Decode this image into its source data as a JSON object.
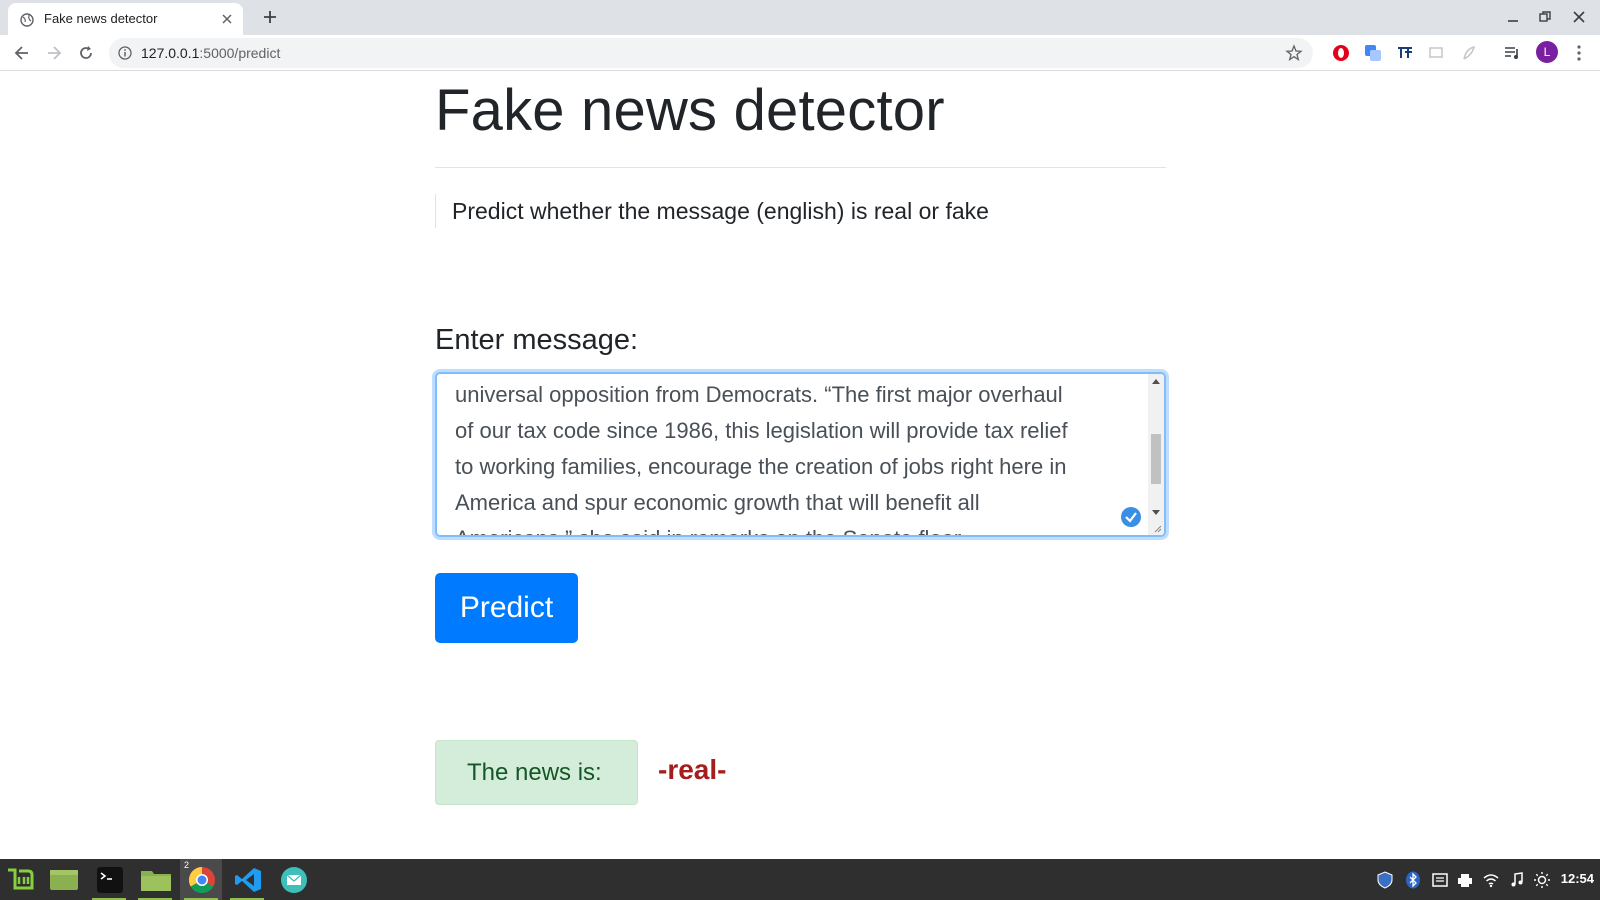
{
  "browser": {
    "tab_title": "Fake news detector",
    "url_host": "127.0.0.1",
    "url_path": ":5000/predict",
    "profile_initial": "L"
  },
  "page": {
    "title": "Fake news detector",
    "subtitle": "Predict whether the message (english) is real or fake",
    "input_label": "Enter message:",
    "message_text": "universal opposition from Democrats. “The first major overhaul\nof our tax code since 1986, this legislation will provide tax relief\nto working families, encourage the creation of jobs right here in\nAmerica and spur economic growth that will benefit all\nAmericans,” she said in remarks on the Senate floor.",
    "predict_label": "Predict",
    "result_label": "The news is:",
    "result_value": "-real-"
  },
  "taskbar": {
    "clock": "12:54",
    "chrome_badge": "2"
  },
  "colors": {
    "primary": "#007bff",
    "result_bg": "#d4edda",
    "result_text": "#155724",
    "result_value": "#a41e1e"
  }
}
